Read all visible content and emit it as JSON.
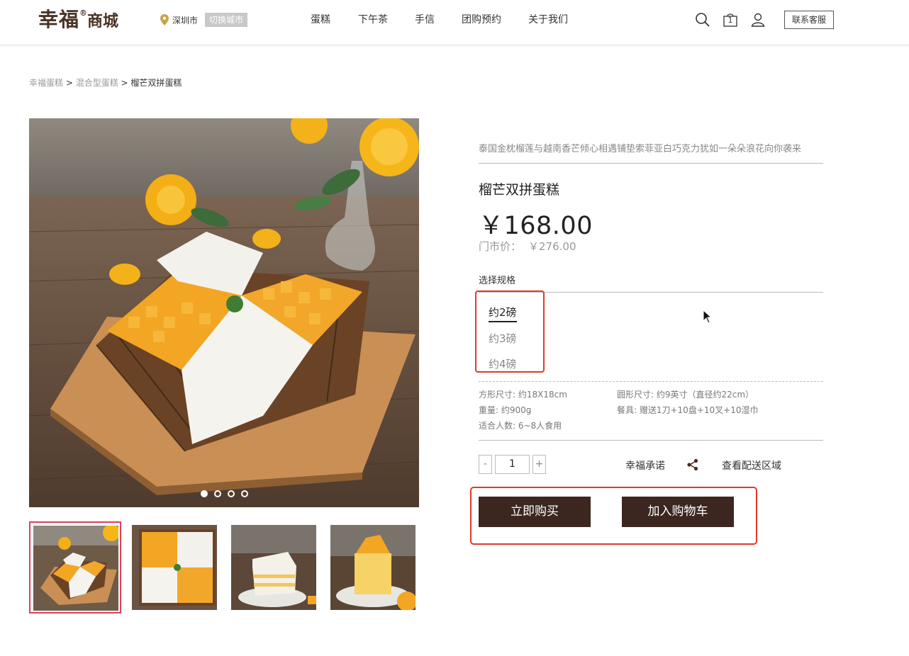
{
  "header": {
    "logo_main": "幸福",
    "logo_reg": "®",
    "logo_sub": "商城",
    "city": "深圳市",
    "switch_city": "切换城市",
    "nav": [
      "蛋糕",
      "下午茶",
      "手信",
      "团购预约",
      "关于我们"
    ],
    "service_button": "联系客服",
    "cart_count": "1",
    "icons": [
      "search-icon",
      "cart-icon",
      "user-icon"
    ]
  },
  "breadcrumb": {
    "crumb1": "幸福蛋糕",
    "sep1": " > ",
    "crumb2": "混合型蛋糕",
    "sep2": " > ",
    "current": "榴芒双拼蛋糕"
  },
  "gallery": {
    "active_index": 0,
    "dot_count": 4,
    "thumbnail_count": 4
  },
  "product": {
    "tagline": "泰国金枕榴莲与越南香芒倾心相遇铺垫索菲亚白巧克力犹如一朵朵浪花向你袭来",
    "name": "榴芒双拼蛋糕",
    "price": "￥168.00",
    "market_price_label": "门市价：",
    "market_price": "￥276.00",
    "spec_label": "选择规格",
    "specs": [
      "约2磅",
      "约3磅",
      "约4磅"
    ],
    "selected_spec_index": 0,
    "info": {
      "square_size": "方形尺寸: 约18X18cm",
      "round_size": "圆形尺寸: 约9英寸（直径约22cm）",
      "weight": "重量: 约900g",
      "tableware": "餐具: 赠送1刀+10盘+10叉+10湿巾",
      "servings": "适合人数: 6~8人食用"
    },
    "quantity": "1",
    "minus": "-",
    "plus": "+",
    "promise": "幸福承诺",
    "delivery": "查看配送区域",
    "buy_now": "立即购买",
    "add_to_cart": "加入购物车"
  },
  "colors": {
    "brand_dark": "#3b2720",
    "highlight_red": "#e03a2a",
    "thumb_active": "#d9415a",
    "logo": "#4a3326"
  }
}
